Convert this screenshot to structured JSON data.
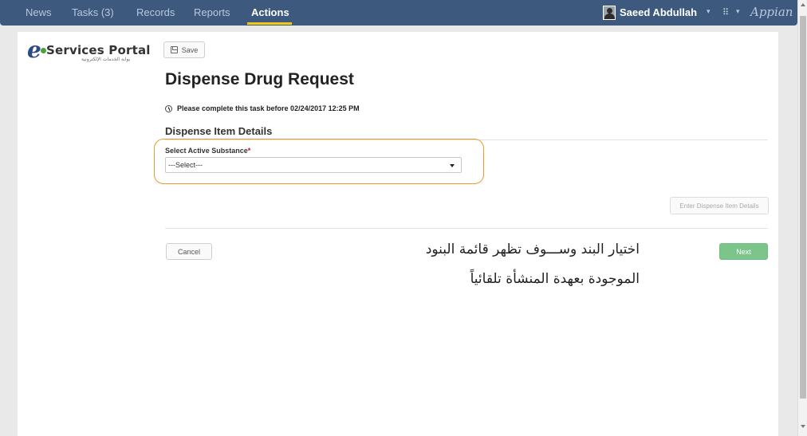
{
  "nav": {
    "items": [
      {
        "label": "News"
      },
      {
        "label": "Tasks (3)"
      },
      {
        "label": "Records"
      },
      {
        "label": "Reports"
      },
      {
        "label": "Actions",
        "active": true
      }
    ],
    "user": "Saeed Abdullah",
    "brand": "Appian",
    "apps_icon": "grid-icon"
  },
  "logo": {
    "main": "Services Portal",
    "letter": "e",
    "sub": "بوابة الخدمات الإلكترونية"
  },
  "toolbar": {
    "save_label": "Save"
  },
  "form": {
    "title": "Dispense Drug Request",
    "deadline": "Please complete this task before 02/24/2017 12:25 PM",
    "section": "Dispense Item Details",
    "field_label": "Select Active Substance",
    "required_mark": "*",
    "select_value": "---Select---",
    "enter_details_label": "Enter Dispense Item Details",
    "cancel_label": "Cancel",
    "next_label": "Next"
  },
  "annotation": {
    "line1": "اختيار البند وســـوف تظهر قائمة البنود",
    "line2": "الموجودة بعهدة المنشأة تلقائياً"
  },
  "colors": {
    "topbar": "#3d5a7e",
    "active_underline": "#f1c70f",
    "highlight": "#e69b2a",
    "next_button": "#7cc58a"
  }
}
